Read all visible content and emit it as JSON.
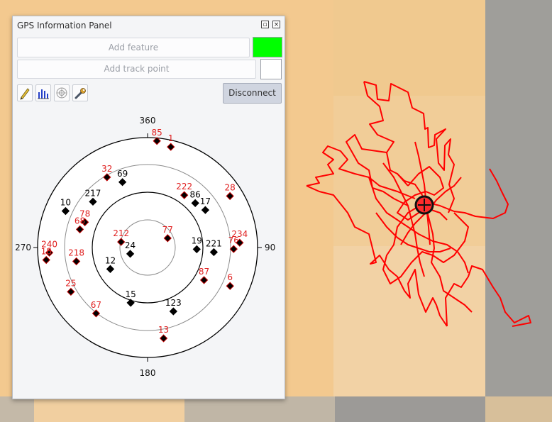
{
  "panel": {
    "title": "GPS Information Panel",
    "restore_glyph": "▫",
    "close_glyph": "×",
    "add_feature_label": "Add feature",
    "add_track_point_label": "Add track point",
    "fix_color": "#00ff00",
    "disconnect_label": "Disconnect",
    "tools": [
      "pencil-icon",
      "bar-chart-icon",
      "satellite-radar-icon",
      "wrench-icon"
    ]
  },
  "skyplot": {
    "directions": [
      "360",
      "90",
      "180",
      "270"
    ],
    "used_color": "#000000",
    "unused_color": "#e02020",
    "satellites": [
      {
        "prn": "85",
        "azimuth": 5,
        "elevation": 3,
        "used": false
      },
      {
        "prn": "1",
        "azimuth": 13,
        "elevation": 6,
        "used": false
      },
      {
        "prn": "32",
        "azimuth": 330,
        "elevation": 24,
        "used": false
      },
      {
        "prn": "69",
        "azimuth": 339,
        "elevation": 33,
        "used": true
      },
      {
        "prn": "217",
        "azimuth": 310,
        "elevation": 32,
        "used": true
      },
      {
        "prn": "222",
        "azimuth": 35,
        "elevation": 38,
        "used": false
      },
      {
        "prn": "28",
        "azimuth": 58,
        "elevation": 11,
        "used": false
      },
      {
        "prn": "86",
        "azimuth": 47,
        "elevation": 37,
        "used": true
      },
      {
        "prn": "17",
        "azimuth": 57,
        "elevation": 34,
        "used": true
      },
      {
        "prn": "10",
        "azimuth": 294,
        "elevation": 17,
        "used": true
      },
      {
        "prn": "78",
        "azimuth": 292,
        "elevation": 35,
        "used": false
      },
      {
        "prn": "68",
        "azimuth": 285,
        "elevation": 33,
        "used": false
      },
      {
        "prn": "77",
        "azimuth": 65,
        "elevation": 72,
        "used": false
      },
      {
        "prn": "212",
        "azimuth": 282,
        "elevation": 68,
        "used": false
      },
      {
        "prn": "24",
        "azimuth": 250,
        "elevation": 75,
        "used": true
      },
      {
        "prn": "19",
        "azimuth": 92,
        "elevation": 50,
        "used": true
      },
      {
        "prn": "221",
        "azimuth": 94,
        "elevation": 36,
        "used": true
      },
      {
        "prn": "76",
        "azimuth": 91,
        "elevation": 20,
        "used": false
      },
      {
        "prn": "234",
        "azimuth": 87,
        "elevation": 15,
        "used": false
      },
      {
        "prn": "240",
        "azimuth": 267,
        "elevation": 10,
        "used": false
      },
      {
        "prn": "18",
        "azimuth": 263,
        "elevation": 7,
        "used": false
      },
      {
        "prn": "218",
        "azimuth": 259,
        "elevation": 31,
        "used": false
      },
      {
        "prn": "12",
        "azimuth": 240,
        "elevation": 55,
        "used": true
      },
      {
        "prn": "87",
        "azimuth": 120,
        "elevation": 37,
        "used": false
      },
      {
        "prn": "6",
        "azimuth": 115,
        "elevation": 16,
        "used": false
      },
      {
        "prn": "25",
        "azimuth": 240,
        "elevation": 18,
        "used": false
      },
      {
        "prn": "67",
        "azimuth": 218,
        "elevation": 22,
        "used": false
      },
      {
        "prn": "15",
        "azimuth": 197,
        "elevation": 43,
        "used": true
      },
      {
        "prn": "123",
        "azimuth": 158,
        "elevation": 34,
        "used": true
      },
      {
        "prn": "13",
        "azimuth": 170,
        "elevation": 15,
        "used": false
      }
    ]
  },
  "map": {
    "track_color": "#ff0000",
    "position_marker": "gps-position-icon"
  }
}
